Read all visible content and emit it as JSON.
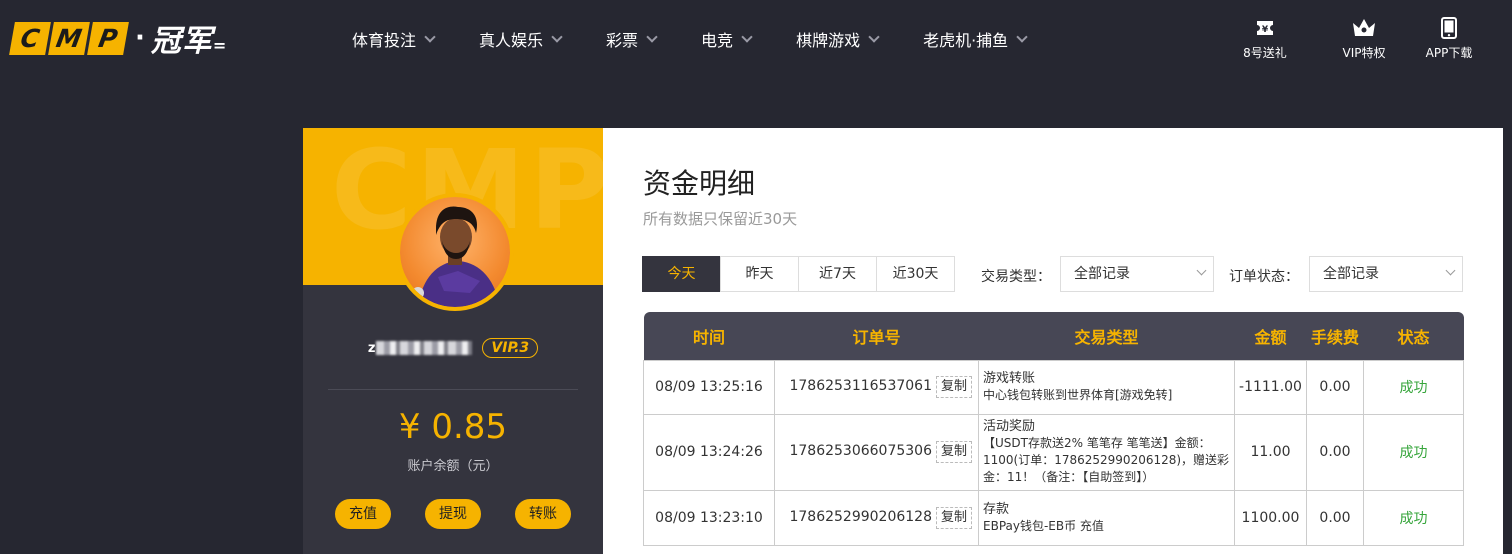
{
  "logo": {
    "letters": [
      "C",
      "M",
      "P"
    ],
    "dot": "·",
    "cn": "冠军",
    "tail": "="
  },
  "nav": [
    {
      "label": "体育投注"
    },
    {
      "label": "真人娱乐"
    },
    {
      "label": "彩票"
    },
    {
      "label": "电竞"
    },
    {
      "label": "棋牌游戏"
    },
    {
      "label": "老虎机·捕鱼"
    }
  ],
  "tools": [
    {
      "label": "8号送礼",
      "icon": "gift-ticket-icon"
    },
    {
      "label": "VIP特权",
      "icon": "crown-icon"
    },
    {
      "label": "APP下载",
      "icon": "phone-icon"
    }
  ],
  "card": {
    "watermark": "CMP",
    "username_initial": "z",
    "vip": "VIP.3",
    "balance": "¥ 0.85",
    "balance_label": "账户余额（元）",
    "buttons": [
      "充值",
      "提现",
      "转账"
    ]
  },
  "panel": {
    "title": "资金明细",
    "subtitle": "所有数据只保留近30天",
    "tabs": [
      "今天",
      "昨天",
      "近7天",
      "近30天"
    ],
    "active_tab": 0,
    "tx_type_label": "交易类型：",
    "tx_type_value": "全部记录",
    "order_status_label": "订单状态：",
    "order_status_value": "全部记录"
  },
  "table": {
    "headers": [
      "时间",
      "订单号",
      "交易类型",
      "金额",
      "手续费",
      "状态"
    ],
    "copy_label": "复制",
    "rows": [
      {
        "time": "08/09 13:25:16",
        "order": "1786253116537061",
        "type_main": "游戏转账",
        "type_detail": "中心钱包转账到世界体育[游戏免转]",
        "amount": "-1111.00",
        "fee": "0.00",
        "status": "成功"
      },
      {
        "time": "08/09 13:24:26",
        "order": "1786253066075306",
        "type_main": "活动奖励",
        "type_detail": "【USDT存款送2% 笔笔存 笔笔送】金额：1100(订单：1786252990206128)，赠送彩金：11！（备注：【自助签到】）",
        "amount": "11.00",
        "fee": "0.00",
        "status": "成功"
      },
      {
        "time": "08/09 13:23:10",
        "order": "1786252990206128",
        "type_main": "存款",
        "type_detail": "EBPay钱包-EB币 充值",
        "amount": "1100.00",
        "fee": "0.00",
        "status": "成功"
      }
    ]
  },
  "colors": {
    "accent": "#f6b300",
    "bg": "#262731",
    "card": "#34343e",
    "success": "#36a53b"
  }
}
